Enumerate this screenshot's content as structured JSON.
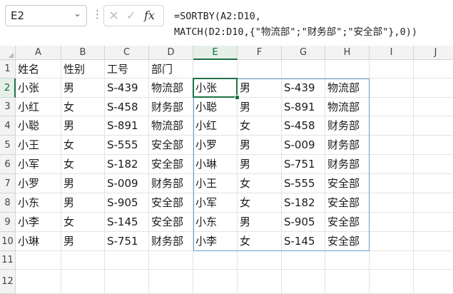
{
  "formula_bar": {
    "name_box": "E2",
    "cancel_icon": "×",
    "enter_icon": "✓",
    "fx_label": "fx",
    "formula_line1": "=SORTBY(A2:D10,",
    "formula_line2": "MATCH(D2:D10,{\"物流部\";\"财务部\";\"安全部\"},0))"
  },
  "columns": [
    "A",
    "B",
    "C",
    "D",
    "E",
    "F",
    "G",
    "H",
    "I",
    "J"
  ],
  "rows": [
    "1",
    "2",
    "3",
    "4",
    "5",
    "6",
    "7",
    "8",
    "9",
    "10",
    "11",
    "12"
  ],
  "selected_cell": "E2",
  "source_table": [
    [
      "姓名",
      "性别",
      "工号",
      "部门"
    ],
    [
      "小张",
      "男",
      "S-439",
      "物流部"
    ],
    [
      "小红",
      "女",
      "S-458",
      "财务部"
    ],
    [
      "小聪",
      "男",
      "S-891",
      "物流部"
    ],
    [
      "小王",
      "女",
      "S-555",
      "安全部"
    ],
    [
      "小军",
      "女",
      "S-182",
      "安全部"
    ],
    [
      "小罗",
      "男",
      "S-009",
      "财务部"
    ],
    [
      "小东",
      "男",
      "S-905",
      "安全部"
    ],
    [
      "小李",
      "女",
      "S-145",
      "安全部"
    ],
    [
      "小琳",
      "男",
      "S-751",
      "财务部"
    ]
  ],
  "spill_result": [
    [
      "小张",
      "男",
      "S-439",
      "物流部"
    ],
    [
      "小聪",
      "男",
      "S-891",
      "物流部"
    ],
    [
      "小红",
      "女",
      "S-458",
      "财务部"
    ],
    [
      "小罗",
      "男",
      "S-009",
      "财务部"
    ],
    [
      "小琳",
      "男",
      "S-751",
      "财务部"
    ],
    [
      "小王",
      "女",
      "S-555",
      "安全部"
    ],
    [
      "小军",
      "女",
      "S-182",
      "安全部"
    ],
    [
      "小东",
      "男",
      "S-905",
      "安全部"
    ],
    [
      "小李",
      "女",
      "S-145",
      "安全部"
    ]
  ],
  "colors": {
    "selection": "#1e7145",
    "spill_border": "#6d9bd1"
  }
}
